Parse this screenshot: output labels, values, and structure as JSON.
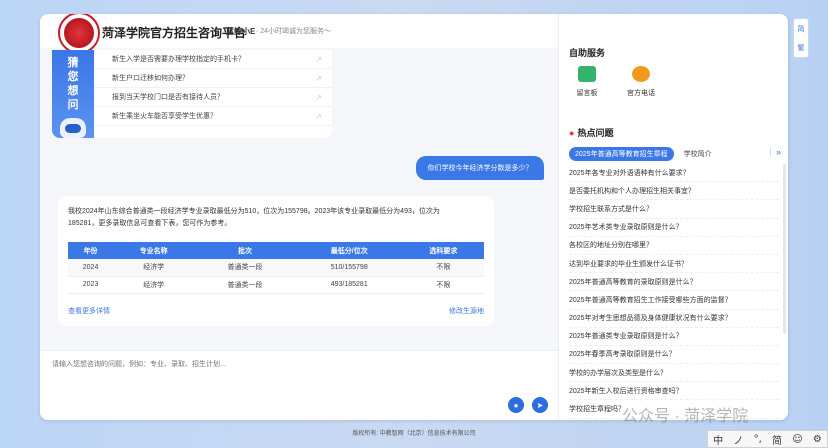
{
  "header": {
    "title": "菏泽学院官方招生咨询平台",
    "brand_tag": "蓝鲸小E",
    "slogan": "· 24小时竭诚为您服务～"
  },
  "faq": {
    "banner_chars": [
      "猜",
      "您",
      "想",
      "问"
    ],
    "items": [
      "新生入学是否需要办理学校指定的手机卡？",
      "新生户口迁移如何办理？",
      "报到当天学校门口是否有接待人员？",
      "新生乘坐火车能否享受学生优惠？"
    ]
  },
  "chat": {
    "user_question": "你们学校今年经济学分数是多少？",
    "answer_text": "我校2024年山东综合普通类一段经济学专业录取最低分为510，位次为155798。2023年该专业录取最低分为493，位次为185281，更多录取信息可查看下表，您可作为参考。",
    "table": {
      "headers": [
        "年份",
        "专业名称",
        "批次",
        "最低分/位次",
        "选科要求"
      ],
      "rows": [
        [
          "2024",
          "经济学",
          "普通类一段",
          "510/155798",
          "不限"
        ],
        [
          "2023",
          "经济学",
          "普通类一段",
          "493/185281",
          "不限"
        ]
      ]
    },
    "more_link": "查看更多详情",
    "edit_link": "修改生源地"
  },
  "input": {
    "placeholder": "请输入您想咨询的问题，例如：专业、录取、招生计划..."
  },
  "sidebar": {
    "services_title": "自助服务",
    "services": [
      {
        "label": "留言板",
        "color": "#34b36b"
      },
      {
        "label": "官方电话",
        "color": "#f39a1e"
      }
    ],
    "hot_title": "热点问题",
    "hot_tab_active": "2025年普通高等教育招生章程",
    "hot_tab_other": "学校简介",
    "hot_items": [
      "2025年各专业对外语语种有什么要求？",
      "是否委托机构和个人办理招生相关事宜？",
      "学校招生联系方式是什么？",
      "2025年艺术类专业录取原则是什么？",
      "各校区的地址分别在哪里？",
      "达到毕业要求的毕业生颁发什么证书？",
      "2025年普通高等教育的录取原则是什么？",
      "2025年普通高等教育招生工作接受哪些方面的监督？",
      "2025年对考生思想品德及身体健康状况有什么要求？",
      "2025年普通类专业录取原则是什么？",
      "2025年春季高考录取原则是什么？",
      "学校的办学层次及类型是什么？",
      "2025年新生入校后进行资格审查吗？",
      "学校招生章程吗？"
    ]
  },
  "lang": {
    "simplified": "简",
    "traditional": "繁"
  },
  "footer": "版权所有: 中教智网（北京）信息技术有限公司",
  "watermark": "公众号 · 菏泽学院",
  "ime": [
    "中",
    "ノ",
    "°,",
    "简",
    "☺",
    "⚙"
  ]
}
